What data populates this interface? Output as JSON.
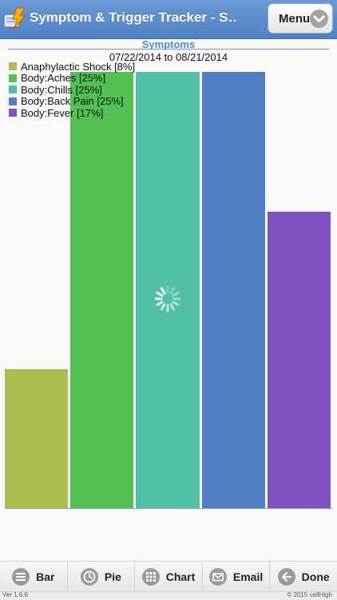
{
  "header": {
    "title": "Symptom & Trigger Tracker - S…",
    "menu_label": "Menu"
  },
  "chart_data": {
    "type": "bar",
    "title": "Symptoms",
    "subtitle": "07/22/2014 to 08/21/2014",
    "categories": [
      "Anaphylactic Shock",
      "Body:Aches",
      "Body:Chills",
      "Body:Back Pain",
      "Body:Fever"
    ],
    "legend": [
      "Anaphylactic Shock [8%]",
      "Body:Aches [25%]",
      "Body:Chills [25%]",
      "Body:Back Pain [25%]",
      "Body:Fever [17%]"
    ],
    "values": [
      8,
      25,
      25,
      25,
      17
    ],
    "ylim": [
      0,
      25
    ],
    "colors": [
      "#abbd4e",
      "#52c052",
      "#52c0a6",
      "#517fc4",
      "#7f52c0"
    ],
    "legend_position": "top-left",
    "grid": false
  },
  "toolbar": {
    "items": [
      {
        "label": "Bar",
        "icon": "menu-lines-icon"
      },
      {
        "label": "Pie",
        "icon": "clock-icon"
      },
      {
        "label": "Chart",
        "icon": "grid-icon"
      },
      {
        "label": "Email",
        "icon": "envelope-icon"
      },
      {
        "label": "Done",
        "icon": "arrow-left-icon"
      }
    ]
  },
  "footer": {
    "version": "Ver 1.6.6",
    "copyright": "© 2015 cellHigh"
  }
}
